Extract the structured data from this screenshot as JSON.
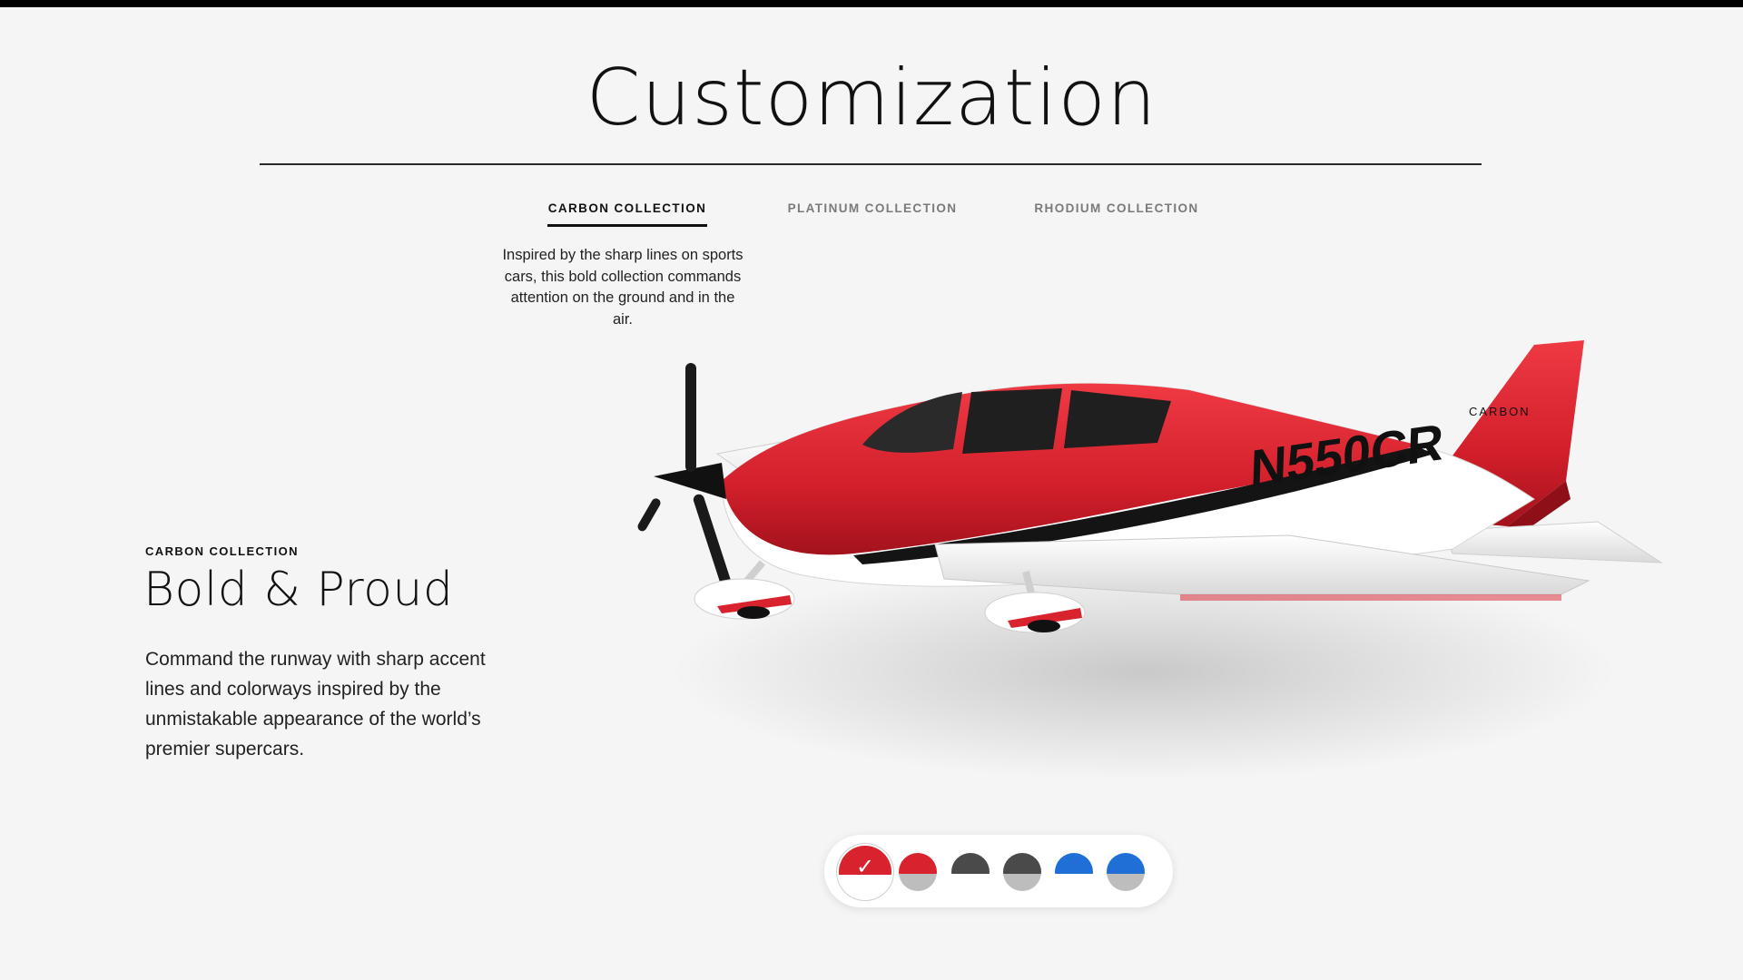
{
  "header": {
    "title": "Customization"
  },
  "tabs": [
    {
      "label": "CARBON COLLECTION",
      "active": true
    },
    {
      "label": "PLATINUM COLLECTION",
      "active": false
    },
    {
      "label": "RHODIUM COLLECTION",
      "active": false
    }
  ],
  "tab_description": "Inspired by the sharp lines on sports cars, this bold collection commands attention on the ground and in the air.",
  "feature": {
    "eyebrow": "CARBON COLLECTION",
    "headline": "Bold & Proud",
    "body": "Command the runway with sharp accent lines and colorways inspired by the unmistakable appearance of the world’s premier supercars."
  },
  "aircraft": {
    "tail_number": "N550CR",
    "tail_mark": "CARBON"
  },
  "swatches": [
    {
      "name": "red-white",
      "top": "#d8232f",
      "bottom": "#ffffff",
      "selected": true
    },
    {
      "name": "red-grey",
      "top": "#d8232f",
      "bottom": "#bdbdbd",
      "selected": false
    },
    {
      "name": "charcoal-white",
      "top": "#4a4a4a",
      "bottom": "#ffffff",
      "selected": false
    },
    {
      "name": "charcoal-grey",
      "top": "#4a4a4a",
      "bottom": "#bdbdbd",
      "selected": false
    },
    {
      "name": "blue-white",
      "top": "#1f6fd6",
      "bottom": "#ffffff",
      "selected": false
    },
    {
      "name": "blue-grey",
      "top": "#1f6fd6",
      "bottom": "#bdbdbd",
      "selected": false
    }
  ],
  "colors": {
    "accent_red": "#d8232f",
    "background": "#f5f5f5",
    "text": "#111111"
  }
}
